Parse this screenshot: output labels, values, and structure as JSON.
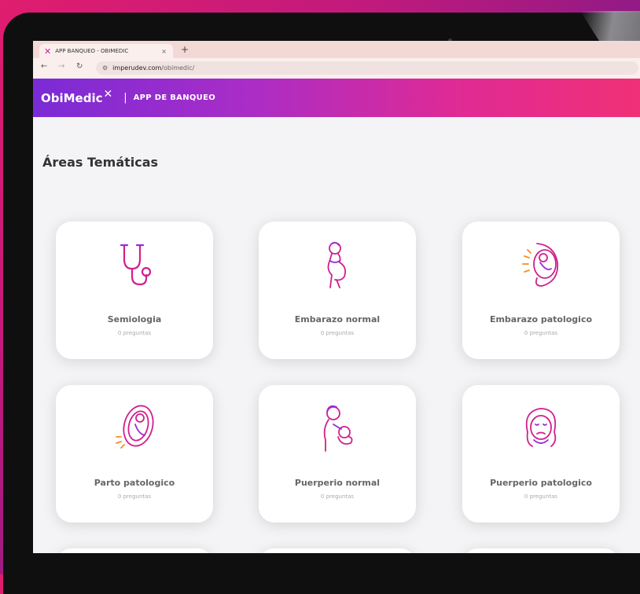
{
  "browser": {
    "tab_title": "APP BANQUEO - OBIMEDIC",
    "tab_close": "×",
    "new_tab": "+",
    "url_host": "imperudev.com",
    "url_path": "/obimedic/"
  },
  "app": {
    "brand": "ObiMedic",
    "separator": "|",
    "subtitle": "APP DE BANQUEO",
    "heading": "Áreas Temáticas"
  },
  "cards": [
    {
      "title": "Semiologia",
      "count": "0 preguntas",
      "icon": "stethoscope-icon"
    },
    {
      "title": "Embarazo normal",
      "count": "0 preguntas",
      "icon": "pregnant-woman-icon"
    },
    {
      "title": "Embarazo patologico",
      "count": "0 preguntas",
      "icon": "fetus-womb-icon"
    },
    {
      "title": "Parto patologico",
      "count": "0 preguntas",
      "icon": "fetus-labor-icon"
    },
    {
      "title": "Puerperio normal",
      "count": "0 preguntas",
      "icon": "mother-baby-icon"
    },
    {
      "title": "Puerperio patologico",
      "count": "0 preguntas",
      "icon": "sad-woman-icon"
    }
  ],
  "colors": {
    "accent": "#d11f8e",
    "appbar_start": "#7a2bd6",
    "appbar_end": "#f03077"
  }
}
